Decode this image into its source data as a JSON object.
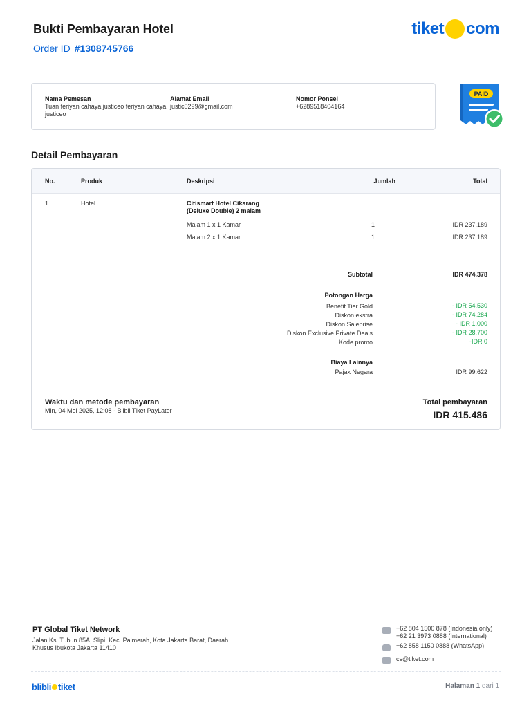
{
  "header": {
    "title": "Bukti Pembayaran Hotel",
    "order_label": "Order ID",
    "order_id": "#1308745766",
    "brand": {
      "left": "tiket",
      "right": "com"
    }
  },
  "customer": {
    "name_label": "Nama Pemesan",
    "name_value": "Tuan feriyan cahaya justiceo feriyan cahaya justiceo",
    "email_label": "Alamat Email",
    "email_value": "justic0299@gmail.com",
    "phone_label": "Nomor Ponsel",
    "phone_value": "+6289518404164"
  },
  "badge": {
    "label": "PAID"
  },
  "payment": {
    "section_title": "Detail Pembayaran",
    "columns": {
      "no": "No.",
      "product": "Produk",
      "description": "Deskripsi",
      "qty": "Jumlah",
      "total": "Total"
    },
    "item": {
      "no": "1",
      "product": "Hotel",
      "name_line1": "Citismart Hotel Cikarang",
      "name_line2": "(Deluxe Double) 2 malam",
      "nights": [
        {
          "desc": "Malam 1 x 1 Kamar",
          "qty": "1",
          "total": "IDR 237.189"
        },
        {
          "desc": "Malam 2 x 1 Kamar",
          "qty": "1",
          "total": "IDR 237.189"
        }
      ]
    },
    "subtotal_label": "Subtotal",
    "subtotal_value": "IDR 474.378",
    "discount_title": "Potongan Harga",
    "discounts": [
      {
        "label": "Benefit Tier Gold",
        "value": "- IDR 54.530"
      },
      {
        "label": "Diskon ekstra",
        "value": "- IDR 74.284"
      },
      {
        "label": "Diskon Saleprise",
        "value": "- IDR 1.000"
      },
      {
        "label": "Diskon Exclusive Private Deals",
        "value": "- IDR 28.700"
      },
      {
        "label": "Kode promo",
        "value": "-IDR 0"
      }
    ],
    "other_title": "Biaya Lainnya",
    "other": [
      {
        "label": "Pajak Negara",
        "value": "IDR 99.622"
      }
    ],
    "method_title": "Waktu dan metode pembayaran",
    "method_value": "Min, 04 Mei 2025, 12:08 - Blibli Tiket PayLater",
    "total_label": "Total pembayaran",
    "total_value": "IDR 415.486"
  },
  "footer": {
    "company": "PT Global Tiket Network",
    "address": "Jalan Ks. Tubun 85A, Slipi, Kec. Palmerah, Kota Jakarta Barat, Daerah Khusus Ibukota Jakarta 11410",
    "phone_id": "+62 804 1500 878 (Indonesia only)",
    "phone_intl": "+62 21 3973 0888 (International)",
    "whatsapp": "+62 858 1150 0888 (WhatsApp)",
    "email": "cs@tiket.com",
    "brand_left": "blibli",
    "brand_right": "tiket",
    "page_label": "Halaman",
    "page_current": "1",
    "page_of": "dari 1"
  }
}
